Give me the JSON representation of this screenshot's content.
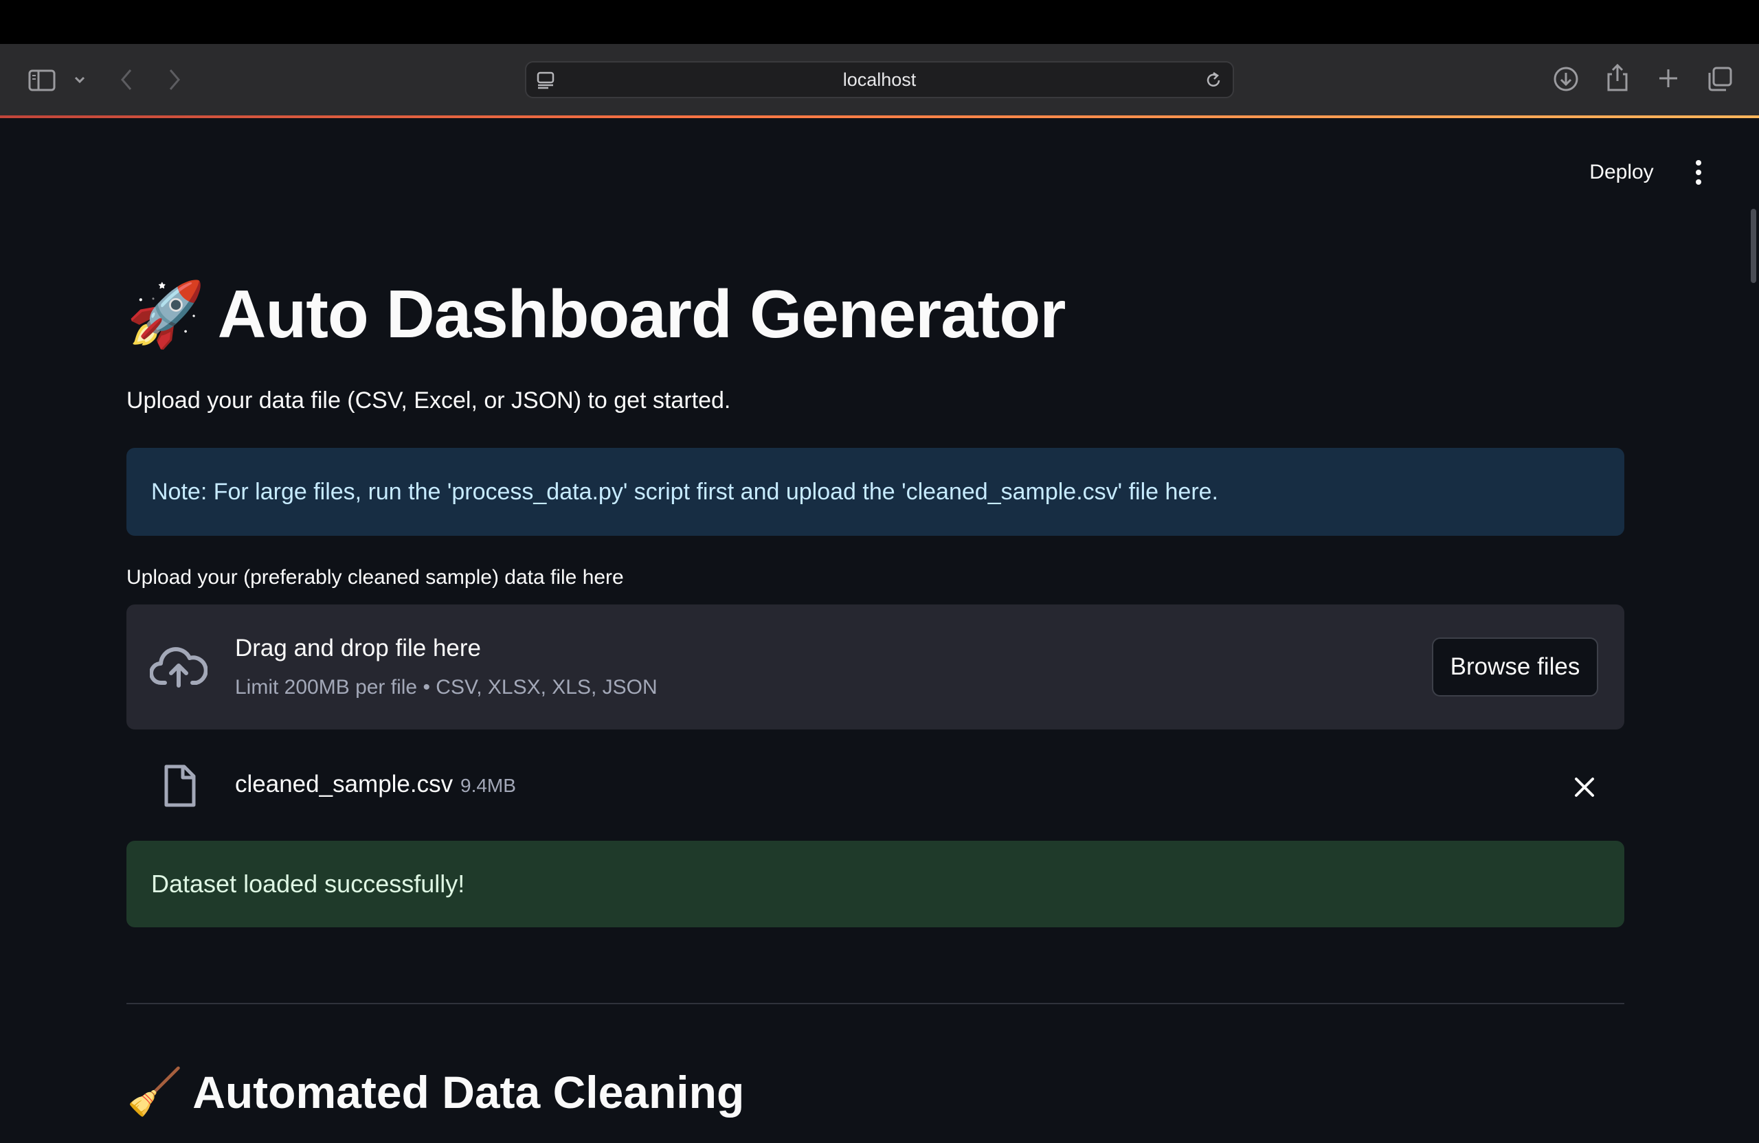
{
  "browser": {
    "url": "localhost"
  },
  "header": {
    "deploy_label": "Deploy"
  },
  "main": {
    "title_emoji": "🚀",
    "title": "Auto Dashboard Generator",
    "subtitle": "Upload your data file (CSV, Excel, or JSON) to get started.",
    "info_note": "Note: For large files, run the 'process_data.py' script first and upload the 'cleaned_sample.csv' file here.",
    "uploader": {
      "label": "Upload your (preferably cleaned sample) data file here",
      "drop_title": "Drag and drop file here",
      "drop_hint": "Limit 200MB per file • CSV, XLSX, XLS, JSON",
      "browse_label": "Browse files"
    },
    "uploaded_file": {
      "name": "cleaned_sample.csv",
      "size": "9.4MB"
    },
    "success_message": "Dataset loaded successfully!",
    "section_emoji": "🧹",
    "section_title": "Automated Data Cleaning"
  },
  "colors": {
    "app_background": "#0e1117",
    "info_background": "#172d43",
    "success_background": "#1f3a2a",
    "dropzone_background": "#262730"
  }
}
